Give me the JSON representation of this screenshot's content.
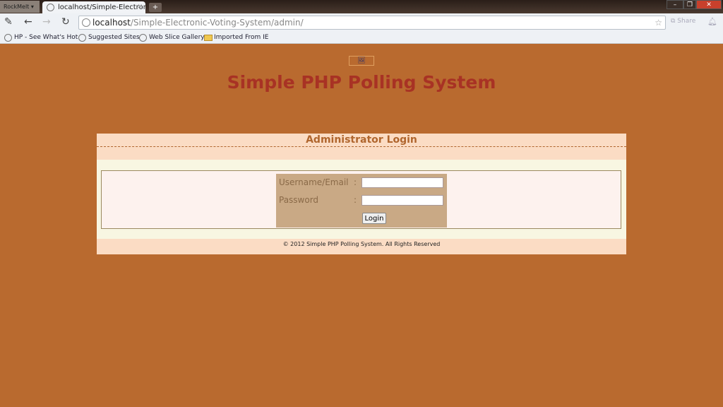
{
  "browser": {
    "menu_label": "RockMelt ▾",
    "tab_title": "localhost/Simple-Electronic",
    "new_tab": "+",
    "window_controls": {
      "minimize": "–",
      "restore": "❐",
      "close": "✕"
    },
    "url_host": "localhost",
    "url_path": "/Simple-Electronic-Voting-System/admin/",
    "share_label": "Share",
    "bookmarks": [
      "HP - See What's Hot",
      "Suggested Sites",
      "Web Slice Gallery",
      "Imported From IE"
    ]
  },
  "page": {
    "site_title": "Simple PHP Polling System",
    "login_heading": "Administrator Login",
    "username_label": "Username/Email",
    "password_label": "Password",
    "colon": ":",
    "username_value": "",
    "password_value": "",
    "login_button": "Login",
    "footer": "© 2012 Simple PHP Polling System. All Rights Reserved"
  },
  "colors": {
    "background": "#b96a2f",
    "title": "#a83224",
    "panel": "#fbdcc4",
    "form": "#c9a985"
  }
}
